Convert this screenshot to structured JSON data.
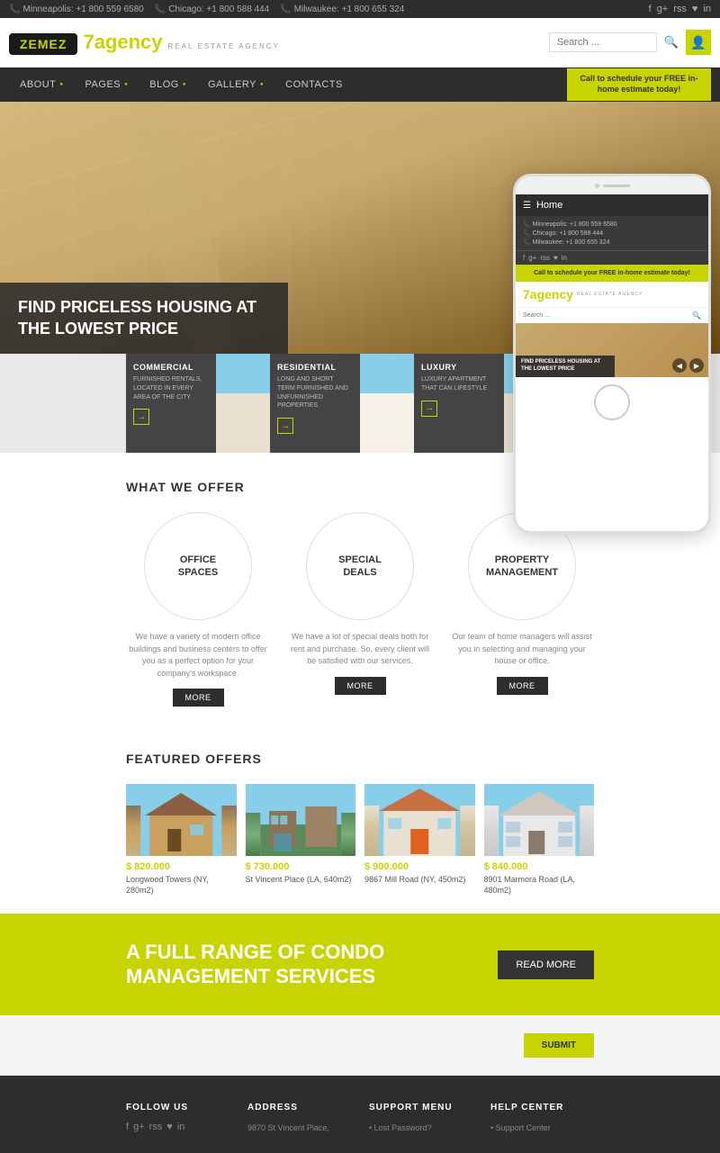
{
  "topbar": {
    "phones": [
      {
        "icon": "📞",
        "text": "Minneapolis: +1 800 559 6580"
      },
      {
        "icon": "📞",
        "text": "Chicago: +1 800 588 444"
      },
      {
        "icon": "📞",
        "text": "Milwaukee: +1 800 655 324"
      }
    ],
    "social_icons": [
      "f",
      "g+",
      "rss",
      "♥",
      "in"
    ]
  },
  "header": {
    "zemez_label": "ZEMEZ",
    "logo_number": "7",
    "logo_agency": "agency",
    "tagline": "REAL ESTATE AGENCY",
    "search_placeholder": "Search ...",
    "search_btn": "🔍"
  },
  "nav": {
    "links": [
      "ABOUT",
      "PAGES",
      "BLOG",
      "GALLERY",
      "CONTACTS"
    ],
    "cta": "Call to schedule your FREE in-home estimate today!"
  },
  "hero": {
    "text": "FIND PRICELESS HOUSING AT THE LOWEST PRICE"
  },
  "property_cards": [
    {
      "title": "COMMERCIAL",
      "desc": "FURNISHED RENTALS, LOCATED IN EVERY AREA OF THE CITY",
      "arrow": "→",
      "type": "building"
    },
    {
      "title": "RESIDENTIAL",
      "desc": "LONG AND SHORT TERM FURNISHED AND UNFURNISHED PROPERTIES",
      "arrow": "→",
      "type": "house"
    },
    {
      "title": "LUXURY",
      "desc": "LUXURY APARTMENT THAT CAN LIFESTYLE",
      "arrow": "→",
      "type": "building"
    }
  ],
  "phone_mockup": {
    "nav_title": "Home",
    "phones": [
      "Minneapolis: +1 800 559 6580",
      "Chicago: +1 800 588 444",
      "Milwaukee: +1 800 655 324"
    ],
    "cta_text": "Call to schedule your FREE in-home estimate today!",
    "logo_number": "7",
    "logo_agency": "agency",
    "tagline": "REAL ESTATE AGENCY",
    "search_placeholder": "Search ...",
    "hero_text": "FIND PRICELESS HOUSING AT THE LOWEST PRICE"
  },
  "what_we_offer": {
    "title": "WHAT WE OFFER",
    "items": [
      {
        "label": "OFFICE\nSPACES",
        "desc": "We have a variety of modern office buildings and business centers to offer you as a perfect option for your company's workspace.",
        "btn": "MORE"
      },
      {
        "label": "SPECIAL\nDEALS",
        "desc": "We have a lot of special deals both for rent and purchase. So, every client will be satisfied with our services.",
        "btn": "MORE"
      },
      {
        "label": "PROPERTY\nMANAGEMENT",
        "desc": "Our team of home managers will assist you in selecting and managing your house or office.",
        "btn": "MORE"
      }
    ]
  },
  "featured_offers": {
    "title": "FEATURED OFFERS",
    "items": [
      {
        "price": "$ 820.000",
        "name": "Longwood Towers (NY, 280m2)",
        "img_class": "property-img-1"
      },
      {
        "price": "$ 730.000",
        "name": "St Vincent Place (LA, 640m2)",
        "img_class": "property-img-2"
      },
      {
        "price": "$ 900.000",
        "name": "9867 Mill Road (NY, 450m2)",
        "img_class": "property-img-3"
      },
      {
        "price": "$ 840.000",
        "name": "8901 Marmora Road (LA, 480m2)",
        "img_class": "property-img-4"
      }
    ]
  },
  "cta_banner": {
    "text": "A FULL RANGE OF CONDO\nMANAGEMENT SERVICES",
    "btn": "READ MORE"
  },
  "footer": {
    "cols": [
      {
        "title": "FOLLOW US",
        "type": "social"
      },
      {
        "title": "ADDRESS",
        "content": "9870 St Vincent Place,"
      },
      {
        "title": "SUPPORT MENU",
        "content": "• Lost Password?"
      },
      {
        "title": "HELP CENTER",
        "content": "• Support Center"
      }
    ]
  }
}
